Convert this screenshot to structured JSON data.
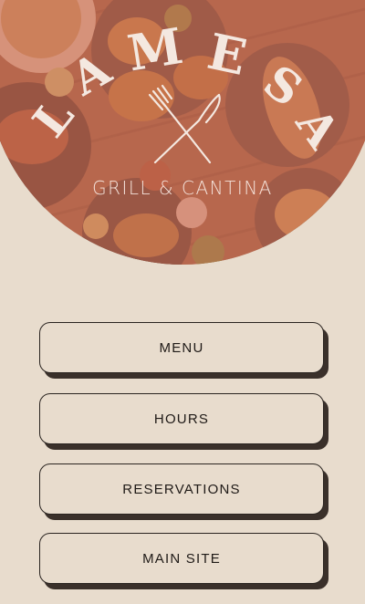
{
  "brand": {
    "name_letters": [
      "L",
      "A",
      "M",
      "E",
      "S",
      "A"
    ],
    "tagline": "GRILL & CANTINA",
    "logo_icon": "crossed-fork-knife-icon"
  },
  "links": [
    {
      "label": "MENU"
    },
    {
      "label": "HOURS"
    },
    {
      "label": "RESERVATIONS"
    },
    {
      "label": "MAIN SITE"
    }
  ],
  "colors": {
    "background": "#e8dccd",
    "hero_overlay": "#c96f57",
    "button_border": "#2a2420",
    "button_shadow": "#3a302a",
    "text": "#1f1a17"
  }
}
